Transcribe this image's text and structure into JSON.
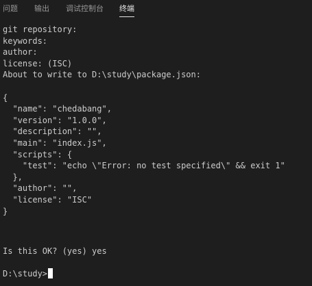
{
  "panel": {
    "tabs": [
      {
        "label": "问题",
        "active": false
      },
      {
        "label": "输出",
        "active": false
      },
      {
        "label": "调试控制台",
        "active": false
      },
      {
        "label": "终端",
        "active": true
      }
    ]
  },
  "terminal": {
    "lines": [
      "git repository:",
      "keywords:",
      "author:",
      "license: (ISC)",
      "About to write to D:\\study\\package.json:",
      "",
      "{",
      "  \"name\": \"chedabang\",",
      "  \"version\": \"1.0.0\",",
      "  \"description\": \"\",",
      "  \"main\": \"index.js\",",
      "  \"scripts\": {",
      "    \"test\": \"echo \\\"Error: no test specified\\\" && exit 1\"",
      "  },",
      "  \"author\": \"\",",
      "  \"license\": \"ISC\"",
      "}",
      "",
      "",
      "Is this OK? (yes) yes"
    ],
    "prompt": "D:\\study>"
  },
  "colors": {
    "background": "#1e1e1e",
    "text": "#cccccc",
    "active_tab": "#e7e7e7",
    "inactive_tab": "#969696",
    "cursor": "#ffffff"
  }
}
